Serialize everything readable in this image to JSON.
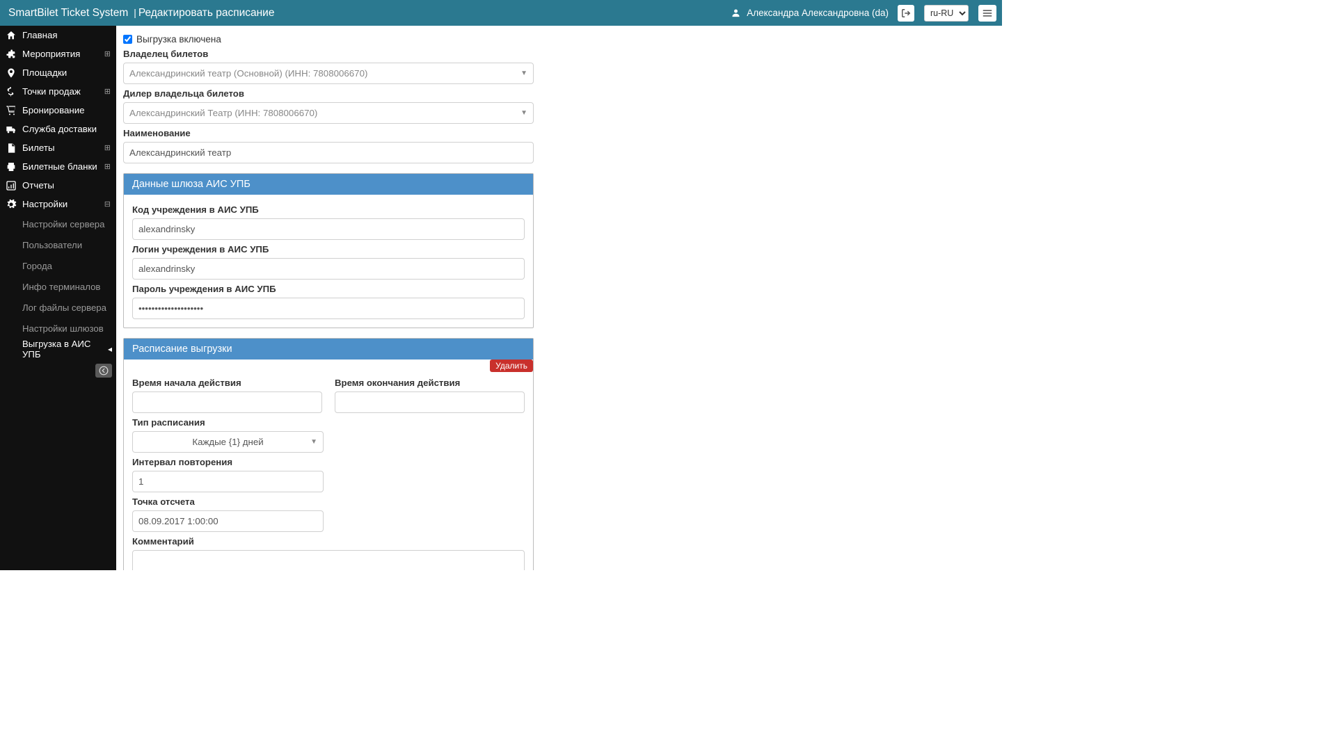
{
  "header": {
    "app_title": "SmartBilet Ticket System",
    "sep": "|",
    "page_title": "Редактировать расписание",
    "user_name": "Александра Александровна (da)",
    "lang_value": "ru-RU"
  },
  "sidebar": {
    "items": [
      {
        "label": "Главная",
        "icon": "home",
        "expandable": false
      },
      {
        "label": "Мероприятия",
        "icon": "puzzle",
        "expandable": true
      },
      {
        "label": "Площадки",
        "icon": "pin",
        "expandable": false
      },
      {
        "label": "Точки продаж",
        "icon": "dollar",
        "expandable": true
      },
      {
        "label": "Бронирование",
        "icon": "cart",
        "expandable": false
      },
      {
        "label": "Служба доставки",
        "icon": "truck",
        "expandable": false
      },
      {
        "label": "Билеты",
        "icon": "doc",
        "expandable": true
      },
      {
        "label": "Билетные бланки",
        "icon": "print",
        "expandable": true
      },
      {
        "label": "Отчеты",
        "icon": "chart",
        "expandable": false
      },
      {
        "label": "Настройки",
        "icon": "gear",
        "expandable": true,
        "expanded": true
      }
    ],
    "sub_items": [
      {
        "label": "Настройки сервера"
      },
      {
        "label": "Пользователи"
      },
      {
        "label": "Города"
      },
      {
        "label": "Инфо терминалов"
      },
      {
        "label": "Лог файлы сервера"
      },
      {
        "label": "Настройки шлюзов"
      },
      {
        "label": "Выгрузка в АИС УПБ"
      }
    ]
  },
  "form": {
    "checkbox_label": "Выгрузка включена",
    "checkbox_checked": true,
    "owner_label": "Владелец билетов",
    "owner_value": "Александринский театр (Основной) (ИНН: 7808006670)",
    "dealer_label": "Дилер владельца билетов",
    "dealer_value": "Александринский Театр (ИНН: 7808006670)",
    "name_label": "Наименование",
    "name_value": "Александринский театр"
  },
  "gateway_panel": {
    "title": "Данные шлюза АИС УПБ",
    "code_label": "Код учреждения в АИС УПБ",
    "code_value": "alexandrinsky",
    "login_label": "Логин учреждения в АИС УПБ",
    "login_value": "alexandrinsky",
    "password_label": "Пароль учреждения в АИС УПБ",
    "password_value": "••••••••••••••••••••"
  },
  "schedule_panel": {
    "title": "Расписание выгрузки",
    "delete_label": "Удалить",
    "start_label": "Время начала действия",
    "start_value": "",
    "end_label": "Время окончания действия",
    "end_value": "",
    "type_label": "Тип расписания",
    "type_value": "Каждые {1} дней",
    "interval_label": "Интервал повторения",
    "interval_value": "1",
    "anchor_label": "Точка отсчета",
    "anchor_value": "08.09.2017 1:00:00",
    "comment_label": "Комментарий",
    "comment_value": ""
  }
}
